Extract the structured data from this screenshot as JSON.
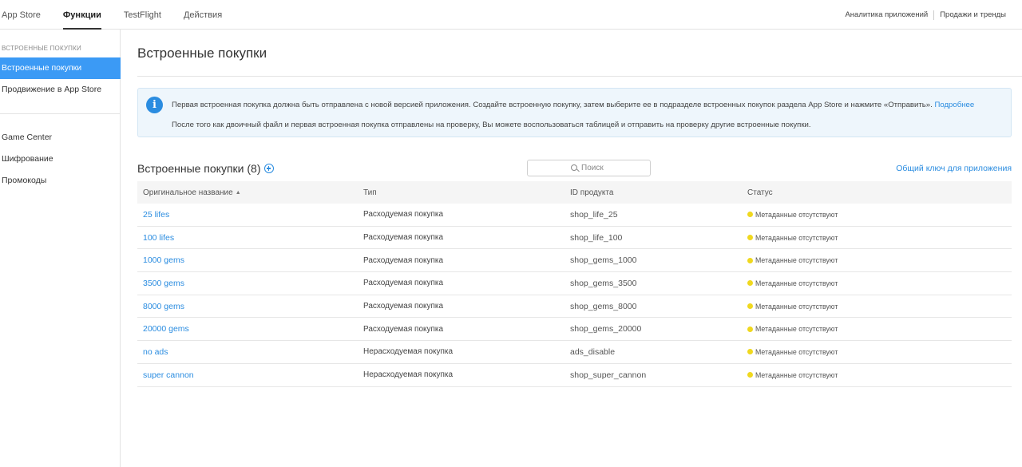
{
  "topnav": {
    "tabs": [
      {
        "label": "App Store",
        "active": false
      },
      {
        "label": "Функции",
        "active": true
      },
      {
        "label": "TestFlight",
        "active": false
      },
      {
        "label": "Действия",
        "active": false
      }
    ],
    "right_links": [
      "Аналитика приложений",
      "Продажи и тренды"
    ]
  },
  "sidebar": {
    "section_label": "ВСТРОЕННЫЕ ПОКУПКИ",
    "items": [
      {
        "label": "Встроенные покупки",
        "active": true
      },
      {
        "label": "Продвижение в App Store",
        "active": false
      },
      {
        "label": "Game Center",
        "active": false
      },
      {
        "label": "Шифрование",
        "active": false
      },
      {
        "label": "Промокоды",
        "active": false
      }
    ]
  },
  "main": {
    "title": "Встроенные покупки",
    "info": {
      "line1": "Первая встроенная покупка должна быть отправлена с новой версией приложения. Создайте встроенную покупку, затем выберите ее в подразделе встроенных покупок раздела App Store и нажмите «Отправить».",
      "line1_link": "Подробнее",
      "line2": "После того как двоичный файл и первая встроенная покупка отправлены на проверку, Вы можете воспользоваться таблицей и отправить на проверку другие встроенные покупки."
    },
    "list_title": "Встроенные покупки (8)",
    "search_placeholder": "Поиск",
    "shared_key_link": "Общий ключ для приложения",
    "table": {
      "headers": [
        "Оригинальное название",
        "Тип",
        "ID продукта",
        "Статус"
      ],
      "sort_indicator": "▲",
      "rows": [
        {
          "name": "25 lifes",
          "type": "Расходуемая покупка",
          "id": "shop_life_25",
          "status": "Метаданные отсутствуют"
        },
        {
          "name": "100 lifes",
          "type": "Расходуемая покупка",
          "id": "shop_life_100",
          "status": "Метаданные отсутствуют"
        },
        {
          "name": "1000 gems",
          "type": "Расходуемая покупка",
          "id": "shop_gems_1000",
          "status": "Метаданные отсутствуют"
        },
        {
          "name": "3500 gems",
          "type": "Расходуемая покупка",
          "id": "shop_gems_3500",
          "status": "Метаданные отсутствуют"
        },
        {
          "name": "8000 gems",
          "type": "Расходуемая покупка",
          "id": "shop_gems_8000",
          "status": "Метаданные отсутствуют"
        },
        {
          "name": "20000 gems",
          "type": "Расходуемая покупка",
          "id": "shop_gems_20000",
          "status": "Метаданные отсутствуют"
        },
        {
          "name": "no ads",
          "type": "Нерасходуемая покупка",
          "id": "ads_disable",
          "status": "Метаданные отсутствуют"
        },
        {
          "name": "super cannon",
          "type": "Нерасходуемая покупка",
          "id": "shop_super_cannon",
          "status": "Метаданные отсутствуют"
        }
      ]
    }
  },
  "colors": {
    "accent": "#2a8ce0",
    "sidebar_active": "#3b9af5",
    "status_pending": "#f0d81e"
  },
  "icons": [
    "info-icon",
    "add-icon",
    "search-icon",
    "status-dot-icon"
  ]
}
